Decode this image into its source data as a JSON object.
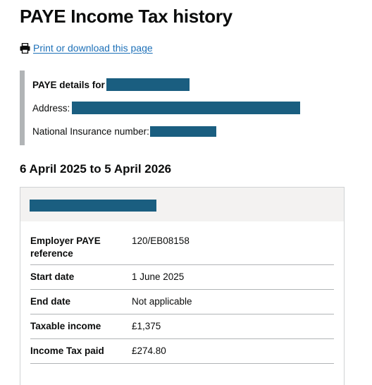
{
  "page": {
    "title": "PAYE Income Tax history"
  },
  "print_link": {
    "label": "Print or download this page",
    "icon": "printer-icon"
  },
  "details": {
    "name_label": "PAYE details for",
    "address_label": "Address:",
    "nino_label": "National Insurance number:"
  },
  "period": {
    "heading": "6 April 2025 to 5 April 2026"
  },
  "employment": {
    "rows": [
      {
        "key": "Employer PAYE reference",
        "value": "120/EB08158"
      },
      {
        "key": "Start date",
        "value": "1 June 2025"
      },
      {
        "key": "End date",
        "value": "Not applicable"
      },
      {
        "key": "Taxable income",
        "value": "£1,375"
      },
      {
        "key": "Income Tax paid",
        "value": "£274.80"
      }
    ]
  },
  "colors": {
    "link": "#1d70b8",
    "redaction": "#1a5e80",
    "inset_border": "#b1b4b6",
    "card_header": "#f3f2f1"
  }
}
